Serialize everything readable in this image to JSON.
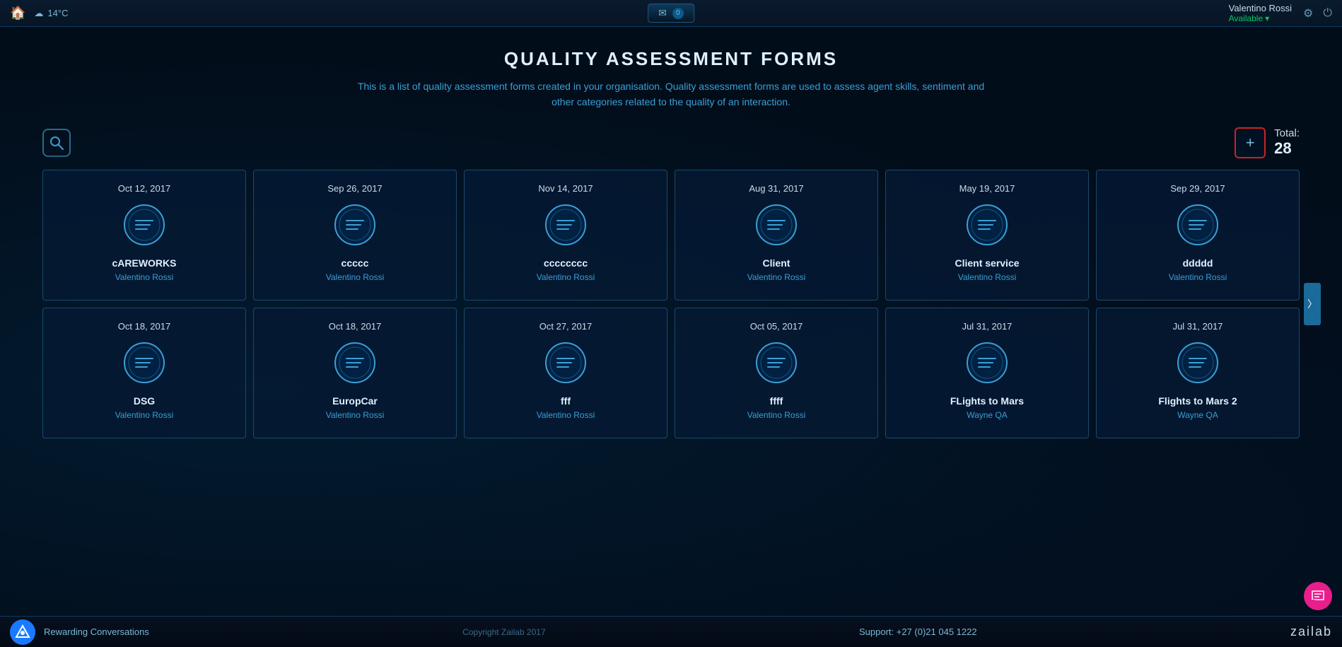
{
  "topbar": {
    "home_icon": "🏠",
    "weather_icon": "☁",
    "temperature": "14°C",
    "mail_icon": "✉",
    "mail_count": "0",
    "user_name": "Valentino Rossi",
    "user_status": "Available",
    "status_arrow": "▾",
    "settings_icon": "⚙",
    "power_icon": "⏻"
  },
  "page": {
    "title": "QUALITY ASSESSMENT FORMS",
    "description": "This is a list of quality assessment forms created in your organisation. Quality assessment forms are used to assess agent skills, sentiment and other categories related to the quality of an interaction."
  },
  "toolbar": {
    "search_label": "Search",
    "add_label": "+",
    "total_label": "Total:",
    "total_count": "28"
  },
  "cards_row1": [
    {
      "date": "Oct 12, 2017",
      "name": "cAREWORKS",
      "owner": "Valentino Rossi"
    },
    {
      "date": "Sep 26, 2017",
      "name": "ccccc",
      "owner": "Valentino Rossi"
    },
    {
      "date": "Nov 14, 2017",
      "name": "cccccccc",
      "owner": "Valentino Rossi"
    },
    {
      "date": "Aug 31, 2017",
      "name": "Client",
      "owner": "Valentino Rossi"
    },
    {
      "date": "May 19, 2017",
      "name": "Client service",
      "owner": "Valentino Rossi"
    },
    {
      "date": "Sep 29, 2017",
      "name": "ddddd",
      "owner": "Valentino Rossi"
    }
  ],
  "cards_row2": [
    {
      "date": "Oct 18, 2017",
      "name": "DSG",
      "owner": "Valentino Rossi"
    },
    {
      "date": "Oct 18, 2017",
      "name": "EuropCar",
      "owner": "Valentino Rossi"
    },
    {
      "date": "Oct 27, 2017",
      "name": "fff",
      "owner": "Valentino Rossi"
    },
    {
      "date": "Oct 05, 2017",
      "name": "ffff",
      "owner": "Valentino Rossi"
    },
    {
      "date": "Jul 31, 2017",
      "name": "FLights to Mars",
      "owner": "Wayne QA"
    },
    {
      "date": "Jul 31, 2017",
      "name": "Flights to Mars 2",
      "owner": "Wayne QA"
    }
  ],
  "footer": {
    "rewarding": "Rewarding Conversations",
    "copyright": "Copyright Zailab 2017",
    "support": "Support: +27 (0)21 045 1222",
    "brand": "zailab"
  }
}
